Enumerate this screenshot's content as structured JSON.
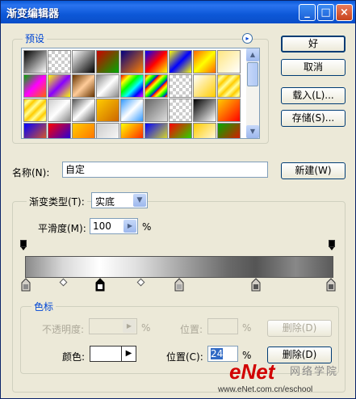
{
  "window": {
    "title": "渐变编辑器",
    "min_glyph": "_",
    "max_glyph": "□",
    "close_glyph": "×"
  },
  "presets": {
    "label": "预设",
    "menu_glyph": "▸"
  },
  "buttons": {
    "ok": "好",
    "cancel": "取消",
    "load": "载入(L)...",
    "save": "存储(S)...",
    "new": "新建(W)",
    "delete_opacity": "删除(D)",
    "delete_color": "删除(D)"
  },
  "name": {
    "label": "名称(N):",
    "value": "自定"
  },
  "gradient": {
    "type_label": "渐变类型(T):",
    "type_value": "实底",
    "smooth_label": "平滑度(M):",
    "smooth_value": "100",
    "smooth_unit": "%"
  },
  "stops": {
    "group_label": "色标",
    "opacity_label": "不透明度:",
    "opacity_unit": "%",
    "opacity_pos_label": "位置:",
    "opacity_pos_unit": "%",
    "color_label": "颜色:",
    "color_value": "#ffffff",
    "color_pos_label": "位置(C):",
    "color_pos_value": "24",
    "color_pos_unit": "%"
  },
  "watermark": {
    "brand": "eNet",
    "cn": "网络学院",
    "url": "www.eNet.com.cn/eschool"
  },
  "colors": {
    "titlebar": "#0a5ad8",
    "accent": "#0046d5",
    "dialog_bg": "#ece9d8"
  }
}
